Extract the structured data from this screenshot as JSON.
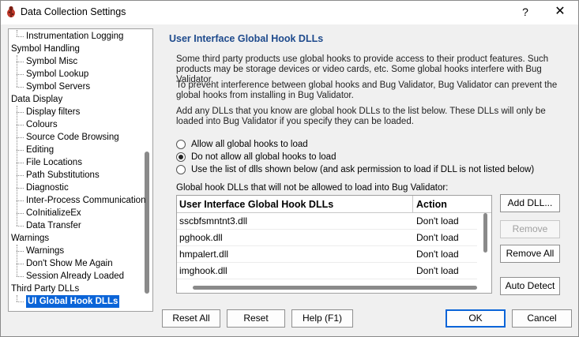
{
  "window": {
    "title": "Data Collection Settings",
    "help_label": "?",
    "close_label": "✕"
  },
  "tree": {
    "items": [
      {
        "label": "Instrumentation Logging",
        "level": 1
      },
      {
        "label": "Symbol Handling",
        "level": 0
      },
      {
        "label": "Symbol Misc",
        "level": 1
      },
      {
        "label": "Symbol Lookup",
        "level": 1
      },
      {
        "label": "Symbol Servers",
        "level": 1
      },
      {
        "label": "Data Display",
        "level": 0
      },
      {
        "label": "Display filters",
        "level": 1
      },
      {
        "label": "Colours",
        "level": 1
      },
      {
        "label": "Source Code Browsing",
        "level": 1
      },
      {
        "label": "Editing",
        "level": 1
      },
      {
        "label": "File Locations",
        "level": 1
      },
      {
        "label": "Path Substitutions",
        "level": 1
      },
      {
        "label": "Diagnostic",
        "level": 1
      },
      {
        "label": "Inter-Process Communication",
        "level": 1
      },
      {
        "label": "CoInitializeEx",
        "level": 1
      },
      {
        "label": "Data Transfer",
        "level": 1
      },
      {
        "label": "Warnings",
        "level": 0
      },
      {
        "label": "Warnings",
        "level": 1
      },
      {
        "label": "Don't Show Me Again",
        "level": 1
      },
      {
        "label": "Session Already Loaded",
        "level": 1
      },
      {
        "label": "Third Party DLLs",
        "level": 0
      },
      {
        "label": "UI Global Hook DLLs",
        "level": 1,
        "selected": true
      }
    ]
  },
  "panel": {
    "title": "User Interface Global Hook DLLs",
    "para1": "Some third party products use global hooks to provide access to their product features. Such products may be storage devices or video cards, etc. Some global hooks interfere with Bug Validator.",
    "para2": "To prevent interference between global hooks and Bug Validator, Bug Validator can prevent the global hooks from installing in Bug Validator.",
    "para3": "Add any DLLs that you know are global hook DLLs to the list below. These DLLs will only be loaded into Bug Validator if you specify they can be loaded.",
    "radios": [
      {
        "label": "Allow all global hooks to load",
        "checked": false
      },
      {
        "label": "Do not allow all global hooks to load",
        "checked": true
      },
      {
        "label": "Use the list of dlls shown below (and ask permission to load if DLL is not listed below)",
        "checked": false
      }
    ],
    "list_label": "Global hook DLLs that will not be allowed to load into Bug Validator:",
    "columns": [
      "User Interface Global Hook DLLs",
      "Action"
    ],
    "rows": [
      {
        "dll": "sscbfsmntnt3.dll",
        "action": "Don't load"
      },
      {
        "dll": "pghook.dll",
        "action": "Don't load"
      },
      {
        "dll": "hmpalert.dll",
        "action": "Don't load"
      },
      {
        "dll": "imghook.dll",
        "action": "Don't load"
      }
    ],
    "add_dll": "Add DLL...",
    "remove": "Remove",
    "remove_all": "Remove All",
    "auto_detect": "Auto Detect"
  },
  "footer": {
    "reset_all": "Reset All",
    "reset": "Reset",
    "help": "Help (F1)",
    "ok": "OK",
    "cancel": "Cancel"
  },
  "colors": {
    "accent": "#0a64d8",
    "panel_title": "#1e4a8c"
  }
}
